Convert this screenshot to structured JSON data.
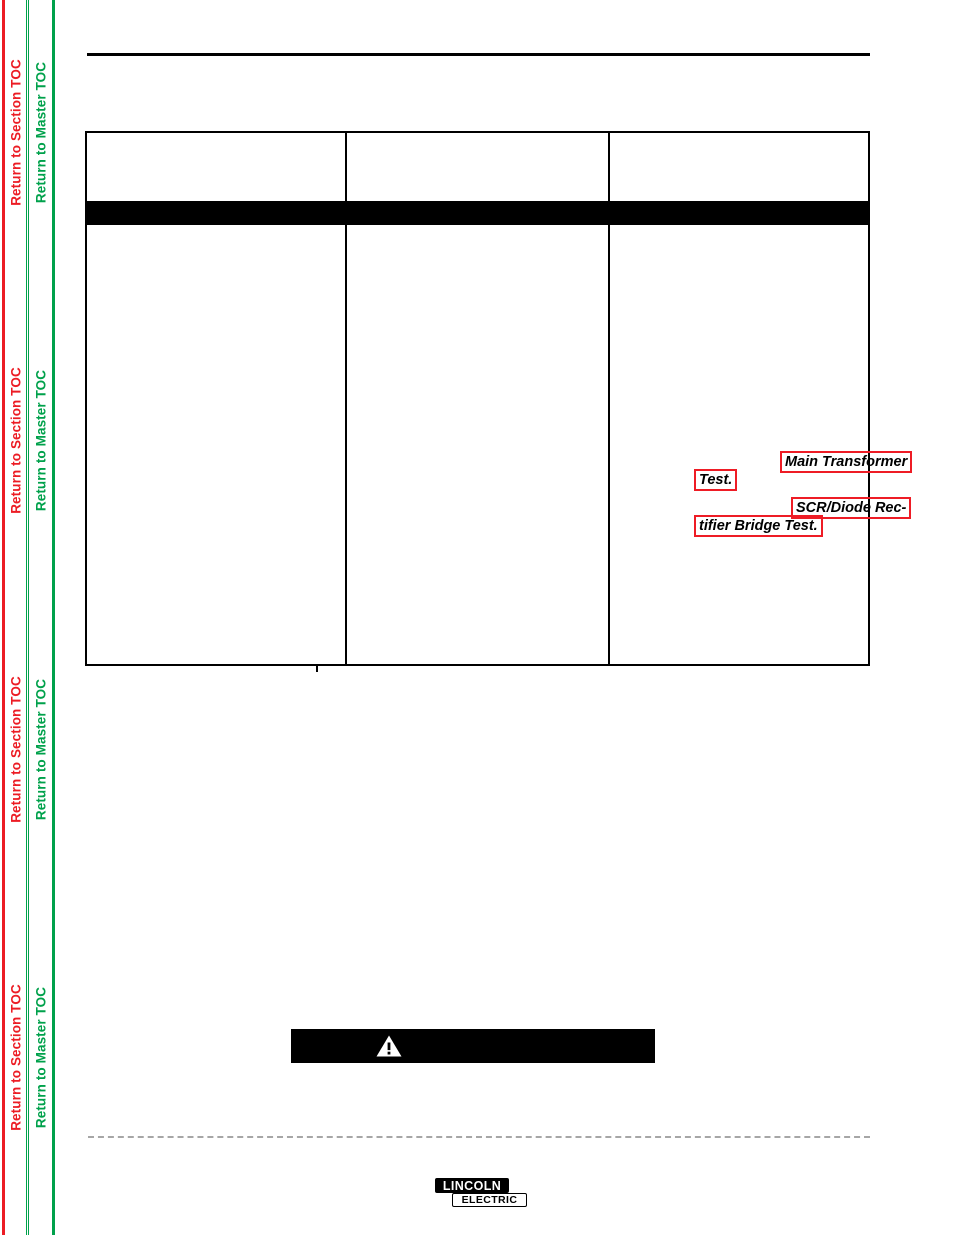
{
  "sidebar": {
    "section_toc_label": "Return to Section TOC",
    "master_toc_label": "Return to Master TOC",
    "section_toc_color": "#ec1c24",
    "master_toc_color": "#00a14b",
    "repeat_count": 4
  },
  "table": {
    "columns": [
      {
        "header": "",
        "body": ""
      },
      {
        "header": "",
        "body": ""
      },
      {
        "header": "",
        "body": ""
      }
    ]
  },
  "links": {
    "main_transformer_line1": "Main Transformer",
    "main_transformer_line2": "Test.",
    "scr_bridge_line1": "SCR/Diode  Rec-",
    "scr_bridge_line2": "tifier Bridge Test.",
    "highlight_color": "#ee1c25"
  },
  "warning": {
    "icon": "warning-triangle-icon",
    "text": "",
    "background_color": "#000000",
    "text_color": "#ffffff"
  },
  "footer": {
    "logo_primary": "LINCOLN",
    "logo_secondary": "ELECTRIC"
  }
}
